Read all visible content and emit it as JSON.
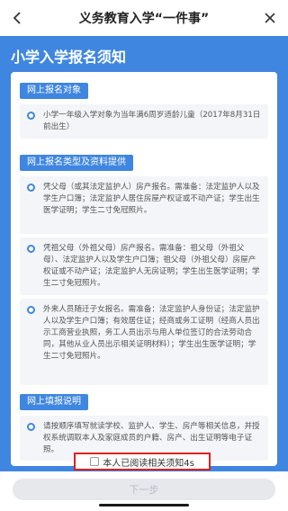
{
  "nav": {
    "title": "义务教育入学“一件事”"
  },
  "panel": {
    "heading": "小学入学报名须知"
  },
  "sections": {
    "s1": {
      "title": "网上报名对象",
      "items": [
        "小学一年级入学对象为当年满6周岁适龄儿童（2017年8月31日前出生）"
      ]
    },
    "s2": {
      "title": "网上报名类型及资料提供",
      "items": [
        "凭父母（或其法定监护人）房产报名。需准备：法定监护人以及学生户口簿；法定监护人居住房屋产权证或不动产证；学生出生医学证明；学生二寸免冠照片。",
        "凭祖父母（外祖父母）房产报名。需准备：祖父母（外祖父母）、法定监护人以及学生户口簿；祖父母（外祖父母）房屋产权证或不动产证；法定监护人无房证明；学生出生医学证明；学生二寸免冠照片。",
        "外来人员随迁子女报名。需准备：法定监护人身份证；法定监护人以及学生户口簿；有效居住证；经商或务工证明（经商人员出示工商营业执照，务工人员出示与用人单位签订的合法劳动合同，其他从业人员出示相关证明材料）；学生出生医学证明；学生二寸免冠照片。"
      ]
    },
    "s3": {
      "title": "网上填报说明",
      "items": [
        "请按顺序填写就读学校、监护人、学生、房产等相关信息，并授权系统调取本人及家庭成员的户籍、房产、出生证明等电子证照。"
      ]
    }
  },
  "agree": {
    "label": "本人已阅读相关须知4s"
  },
  "next_button": {
    "label": "下一步"
  },
  "colors": {
    "accent": "#3f86e0",
    "highlight": "#e02020",
    "disabled_button": "#e6e8ec"
  }
}
